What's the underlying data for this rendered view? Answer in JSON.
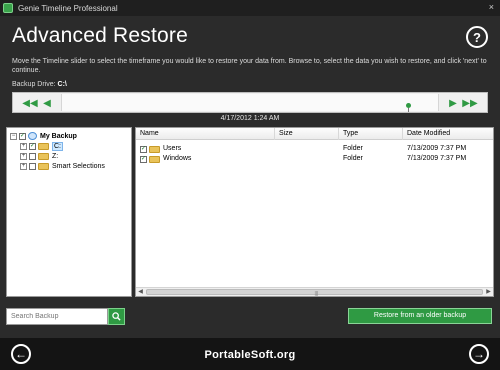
{
  "window": {
    "title": "Genie Timeline Professional",
    "close_glyph": "×"
  },
  "header": {
    "title": "Advanced Restore",
    "help_glyph": "?",
    "instructions": "Move the Timeline slider to select the timeframe you would like to restore your data from. Browse to, select the data you wish to restore, and click 'next' to continue.",
    "backup_drive_label": "Backup Drive:",
    "backup_drive_value": "C:\\"
  },
  "timeline": {
    "date": "4/17/2012 1:24 AM",
    "first_glyph": "◀◀",
    "prev_glyph": "◀",
    "next_glyph": "▶",
    "last_glyph": "▶▶",
    "position": 0.92
  },
  "tree": {
    "root": "My Backup",
    "items": [
      "C:",
      "Z:",
      "Smart Selections"
    ],
    "expand_glyph": "+",
    "collapse_glyph": "−",
    "check_glyph": "✓"
  },
  "list": {
    "columns": [
      "Name",
      "Size",
      "Type",
      "Date Modified"
    ],
    "rows": [
      {
        "name": "Users",
        "size": "",
        "type": "Folder",
        "date": "7/13/2009 7:37 PM"
      },
      {
        "name": "Windows",
        "size": "",
        "type": "Folder",
        "date": "7/13/2009 7:37 PM"
      }
    ],
    "scroll_left": "◀",
    "scroll_right": "▶",
    "grip": "|||"
  },
  "search": {
    "placeholder": "Search Backup"
  },
  "actions": {
    "restore_older": "Restore from an older backup"
  },
  "footer": {
    "text": "PortableSoft.org",
    "back_glyph": "←",
    "next_glyph": "→"
  },
  "colors": {
    "accent": "#2f9a43",
    "background": "#2b2b2b",
    "footer": "#141414"
  }
}
